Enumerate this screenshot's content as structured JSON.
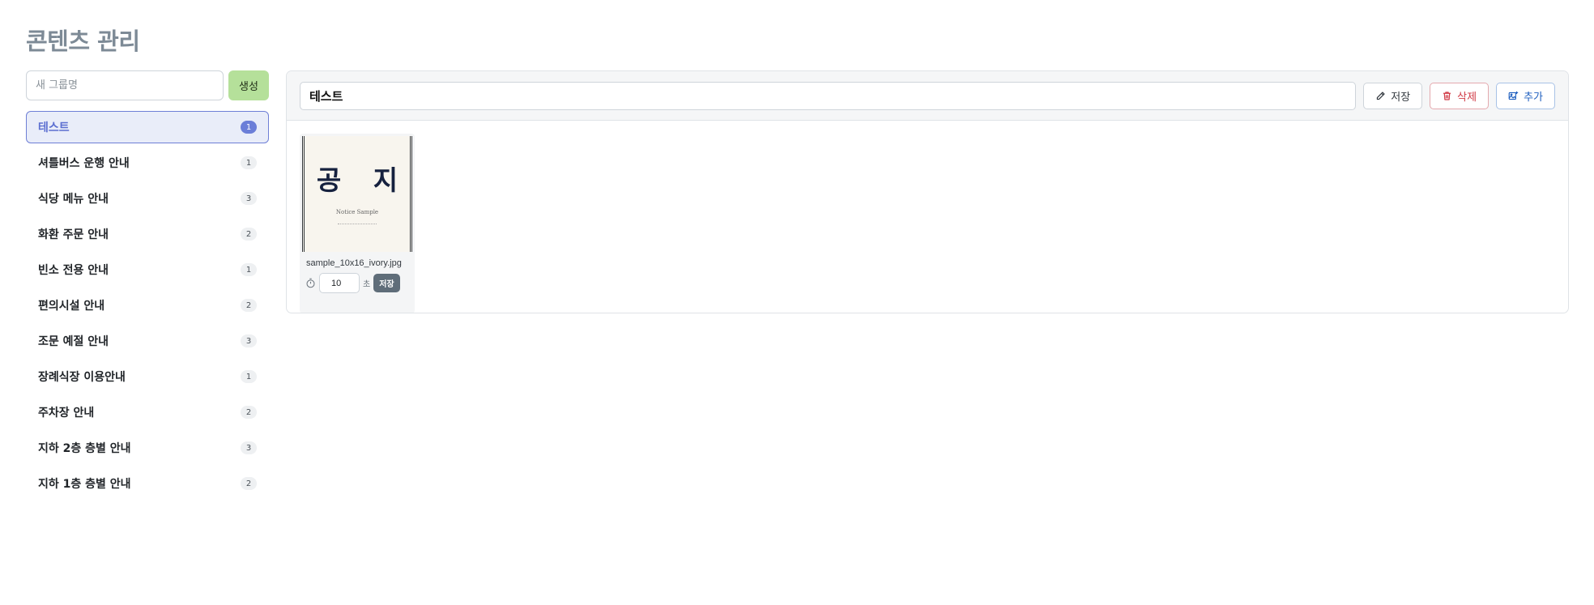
{
  "page": {
    "title": "콘텐츠 관리"
  },
  "sidebar": {
    "new_group_placeholder": "새 그룹명",
    "create_label": "생성",
    "groups": [
      {
        "label": "테스트",
        "count": "1",
        "active": true
      },
      {
        "label": "셔틀버스 운행 안내",
        "count": "1"
      },
      {
        "label": "식당 메뉴 안내",
        "count": "3"
      },
      {
        "label": "화환 주문 안내",
        "count": "2"
      },
      {
        "label": "빈소 전용 안내",
        "count": "1"
      },
      {
        "label": "편의시설 안내",
        "count": "2"
      },
      {
        "label": "조문 예절 안내",
        "count": "3"
      },
      {
        "label": "장례식장 이용안내",
        "count": "1"
      },
      {
        "label": "주차장 안내",
        "count": "2"
      },
      {
        "label": "지하 2층 층별 안내",
        "count": "3"
      },
      {
        "label": "지하 1층 층별 안내",
        "count": "2"
      }
    ]
  },
  "panel": {
    "group_name_value": "테스트",
    "save_label": "저장",
    "delete_label": "삭제",
    "add_label": "추가",
    "media": [
      {
        "thumb_title": "공 지",
        "thumb_subtitle": "Notice Sample",
        "filename": "sample_10x16_ivory.jpg",
        "duration": "10",
        "duration_unit": "초",
        "save_label": "저장"
      }
    ]
  },
  "colors": {
    "accent": "#6b7ed8",
    "create_button": "#b5e09a",
    "delete": "#d13b46",
    "add": "#1f5fbf"
  },
  "icons": {
    "save": "pencil-icon",
    "delete": "trash-icon",
    "add": "image-plus-icon",
    "duration": "timer-icon"
  }
}
